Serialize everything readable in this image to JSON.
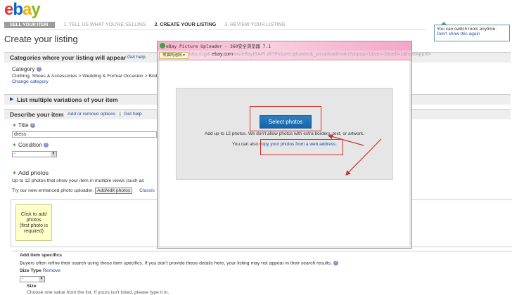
{
  "logo": {
    "l1": "e",
    "l2": "b",
    "l3": "a",
    "l4": "y"
  },
  "steps": {
    "active": "SELL YOUR ITEM",
    "s1": "1. TELL US WHAT YOU'RE SELLING",
    "s2": "2. CREATE YOUR LISTING",
    "s3": "3. REVIEW YOUR LISTING"
  },
  "page_title": "Create your listing",
  "tooltip": {
    "line1": "You can switch tools anytime.",
    "line2": "Don't show this again"
  },
  "categories": {
    "title": "Categories where your listing will appear",
    "help": "Get help",
    "label": "Category",
    "path": "Clothing, Shoes & Accessories > Wedding & Formal Occasion > Brid",
    "change": "Change category"
  },
  "variations": {
    "title": "List multiple variations of your item"
  },
  "describe": {
    "title": "Describe your item",
    "options": "Add or remove options",
    "sep": "|",
    "help": "Get help",
    "title_label": "Title",
    "title_value": "dress",
    "condition_label": "Condition",
    "condition_value": "-",
    "photos_label": "Add photos",
    "photos_desc": "Up to 12 photos that show your item in multiple views (such as",
    "uploader_text": "Try our new enhanced photo uploader.",
    "uploader_button": "Add/edit photos",
    "classic": "Classic",
    "photo_box": [
      "Click to add",
      "photos",
      "(first photo is",
      "required)"
    ]
  },
  "specifics": {
    "title": "Add item specifics",
    "desc": "Buyers often refine their search using these item specifics. If you don't provide these details here, your listing may not appear in their search results.",
    "size_type": "Size Type",
    "remove": "Remove",
    "size_type_value": "-",
    "size_label": "Size",
    "size_desc": "Choose one value from the list. If yours isn't listed, please type it in."
  },
  "dialog": {
    "title": "eBay Picture Uploader - 360安全浏览器 7.1",
    "addr_button": "熊猫阿迪网 ▾",
    "url_prefix": "http://cgi6.",
    "url_domain": "ebay.com",
    "url_rest": "/ws/eBayISAPI.dll?PictureUploader&_picupload/main?popup=1&ver=3&sell=1&hostAppId=",
    "select_button": "Select photos",
    "info1": "Add up to 12 photos. We don't allow photos with extra borders, text, or artwork.",
    "info2_prefix": "You can also ",
    "info2_link": "copy your photos from a web address."
  },
  "colors": {
    "accent_red": "#d42a2a",
    "select_blue": "#1664a8",
    "link_blue": "#1a4b9b"
  }
}
